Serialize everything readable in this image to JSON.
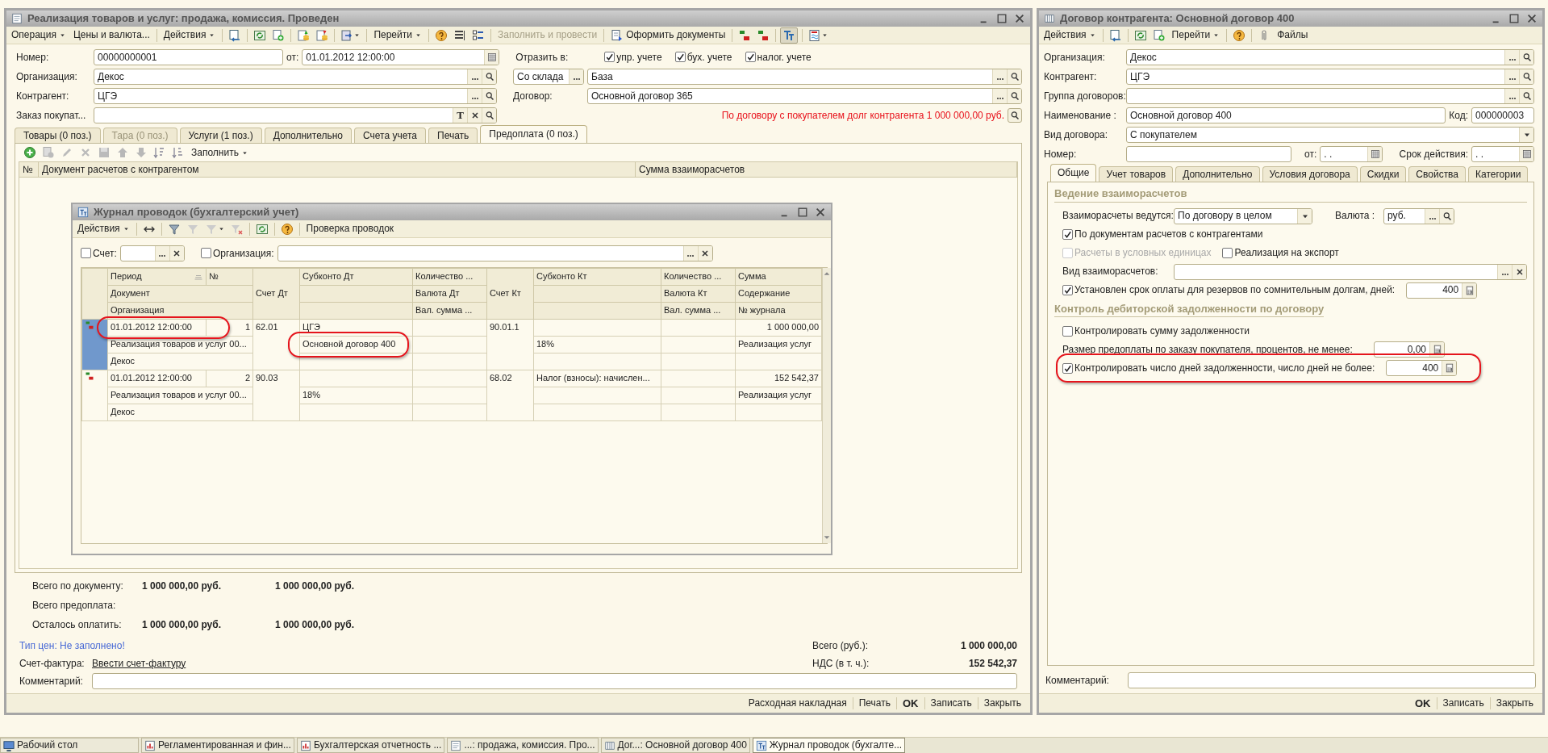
{
  "document_window": {
    "title": "Реализация товаров и услуг: продажа, комиссия. Проведен",
    "toolbar": [
      {
        "label": "Операция",
        "dropdown": true,
        "disabled": false
      },
      {
        "label": "Цены и валюта...",
        "dropdown": false,
        "disabled": false
      },
      {
        "label": "Действия",
        "dropdown": true,
        "disabled": false
      },
      {
        "label": "Перейти",
        "dropdown": true,
        "disabled": false
      },
      {
        "label": "Заполнить и провести",
        "dropdown": false,
        "disabled": true
      },
      {
        "label": "Оформить документы",
        "dropdown": false,
        "disabled": false
      }
    ],
    "toolbar_toggle": {
      "on": true
    },
    "number": {
      "label": "Номер:",
      "value": "00000000001",
      "kind": "text"
    },
    "date": {
      "label": "от:",
      "value": "01.01.2012 12:00:00",
      "kind": "date"
    },
    "reflect_in": {
      "label": "Отразить в:",
      "options": [
        {
          "label": "упр. учете",
          "checked": true
        },
        {
          "label": "бух. учете",
          "checked": true
        },
        {
          "label": "налог. учете",
          "checked": true
        }
      ]
    },
    "organization": {
      "label": "Организация:",
      "value": "Декос",
      "kind": "ref"
    },
    "warehouse_mode": {
      "value": "Со склада",
      "kind": "ref-dots"
    },
    "warehouse": {
      "value": "База",
      "kind": "ref"
    },
    "counterparty": {
      "label": "Контрагент:",
      "value": "ЦГЭ",
      "kind": "ref"
    },
    "contract": {
      "label": "Договор:",
      "value": "Основной договор 365",
      "kind": "ref"
    },
    "order": {
      "label": "Заказ покупат...",
      "kind": "typed-ref",
      "type_button": "T"
    },
    "debt_warning": "По договору с покупателем долг контрагента 1 000 000,00 руб.",
    "tabs": [
      {
        "label": "Товары (0 поз.)",
        "selected": false,
        "disabled": false
      },
      {
        "label": "Тара (0 поз.)",
        "selected": false,
        "disabled": true
      },
      {
        "label": "Услуги (1 поз.)",
        "selected": false,
        "disabled": false
      },
      {
        "label": "Дополнительно",
        "selected": false,
        "disabled": false
      },
      {
        "label": "Счета учета",
        "selected": false,
        "disabled": false
      },
      {
        "label": "Печать",
        "selected": false,
        "disabled": false
      },
      {
        "label": "Предоплата (0 поз.)",
        "selected": true,
        "disabled": false
      }
    ],
    "fill_button": "Заполнить",
    "prepayment_columns": [
      "№",
      "Документ расчетов с контрагентом",
      "Сумма взаиморасчетов"
    ],
    "totals": [
      {
        "label": "Всего по документу:",
        "values": [
          "1 000 000,00 руб.",
          "1 000 000,00 руб."
        ]
      },
      {
        "label": "Всего предоплата:"
      },
      {
        "label": "Осталось оплатить:",
        "values": [
          "1 000 000,00 руб.",
          "1 000 000,00 руб."
        ]
      }
    ],
    "price_type_warning": "Тип цен: Не заполнено!",
    "invoice": {
      "label": "Счет-фактура:",
      "link": "Ввести счет-фактуру"
    },
    "summary": [
      {
        "label": "Всего (руб.):",
        "value": "1 000 000,00"
      },
      {
        "label": "НДС (в т. ч.):",
        "value": "152 542,37"
      }
    ],
    "comment": {
      "label": "Комментарий:"
    },
    "footer_buttons": [
      {
        "label": "Расходная накладная",
        "default": false
      },
      {
        "label": "Печать",
        "default": false
      },
      {
        "label": "OK",
        "default": true
      },
      {
        "label": "Записать",
        "default": false
      },
      {
        "label": "Закрыть",
        "default": false
      }
    ]
  },
  "contract_window": {
    "title": "Договор контрагента: Основной договор 400",
    "toolbar": [
      {
        "label": "Действия",
        "dropdown": true
      },
      {
        "label": "Перейти",
        "dropdown": true
      },
      {
        "label": "Файлы",
        "dropdown": false
      }
    ],
    "organization": {
      "label": "Организация:",
      "value": "Декос",
      "kind": "ref"
    },
    "counterparty": {
      "label": "Контрагент:",
      "value": "ЦГЭ",
      "kind": "ref"
    },
    "group": {
      "label": "Группа договоров:",
      "kind": "ref"
    },
    "name": {
      "label": "Наименование :",
      "value": "Основной договор 400",
      "kind": "text"
    },
    "code": {
      "label": "Код:",
      "value": "000000003",
      "kind": "text"
    },
    "type": {
      "label": "Вид договора:",
      "value": "С покупателем",
      "kind": "select"
    },
    "number": {
      "label": "Номер:",
      "kind": "text"
    },
    "date": {
      "label": "от:",
      "value": ". .",
      "kind": "date"
    },
    "validity": {
      "label": "Срок действия:",
      "value": ". .",
      "kind": "date"
    },
    "tabs": [
      {
        "label": "Общие",
        "selected": true
      },
      {
        "label": "Учет товаров",
        "selected": false
      },
      {
        "label": "Дополнительно",
        "selected": false
      },
      {
        "label": "Условия договора",
        "selected": false
      },
      {
        "label": "Скидки",
        "selected": false
      },
      {
        "label": "Свойства",
        "selected": false
      },
      {
        "label": "Категории",
        "selected": false
      }
    ],
    "settlements": {
      "heading": "Ведение взаиморасчетов",
      "mode": {
        "label": "Взаиморасчеты ведутся:",
        "value": "По договору в целом",
        "kind": "select"
      },
      "currency": {
        "label": "Валюта :",
        "value": "руб.",
        "kind": "ref"
      },
      "by_documents": {
        "label": "По документам расчетов с контрагентами",
        "checked": true,
        "disabled": false
      },
      "conventional_units": {
        "label": "Расчеты в условных единицах",
        "checked": false,
        "disabled": true
      },
      "export": {
        "label": "Реализация на экспорт",
        "checked": false,
        "disabled": false
      },
      "settlement_type": {
        "label": "Вид взаиморасчетов:",
        "kind": "ref-clear"
      },
      "reserve_term": {
        "label": "Установлен срок оплаты для резервов по сомнительным долгам, дней:",
        "checked": true,
        "disabled": false,
        "value": "400",
        "kind": "num"
      }
    },
    "receivables_control": {
      "heading": "Контроль дебиторской задолженности по договору",
      "control_amount": {
        "label": "Контролировать сумму задолженности",
        "checked": false,
        "disabled": false
      },
      "prepayment_size": {
        "label": "Размер предоплаты по заказу покупателя, процентов, не менее:",
        "value": "0,00",
        "kind": "num"
      },
      "control_days": {
        "label": "Контролировать число дней задолженности, число дней не более:",
        "checked": true,
        "disabled": false,
        "value": "400",
        "kind": "num",
        "highlighted": true
      }
    },
    "comment": {
      "label": "Комментарий:"
    },
    "footer_buttons": [
      {
        "label": "OK",
        "default": true
      },
      {
        "label": "Записать",
        "default": false
      },
      {
        "label": "Закрыть",
        "default": false
      }
    ]
  },
  "journal_window": {
    "title": "Журнал проводок (бухгалтерский учет)",
    "toolbar": [
      {
        "label": "Действия",
        "dropdown": true
      },
      {
        "label": "Проверка проводок",
        "dropdown": false
      }
    ],
    "filters": [
      {
        "label": "Счет:",
        "checked": false,
        "kind": "short"
      },
      {
        "label": "Организация:",
        "checked": false,
        "kind": "long"
      }
    ],
    "columns": {
      "period": "Период",
      "number": "№",
      "document": "Документ",
      "organization": "Организация",
      "account_dt": "Счет Дт",
      "subconto_dt": "Субконто Дт",
      "quantity_dt": "Количество ...",
      "currency_dt": "Валюта Дт",
      "currency_amount_dt": "Вал. сумма ...",
      "account_kt": "Счет Кт",
      "subconto_kt": "Субконто Кт",
      "quantity_kt": "Количество ...",
      "currency_kt": "Валюта Кт",
      "currency_amount_kt": "Вал. сумма ...",
      "amount": "Сумма",
      "content": "Содержание",
      "journal_number": "№ журнала"
    },
    "entries": [
      {
        "selected": true,
        "period_highlighted": true,
        "subconto_highlighted": true,
        "period": "01.01.2012 12:00:00",
        "number": "1",
        "document": "Реализация товаров и услуг 00...",
        "organization": "Декос",
        "account_dt": "62.01",
        "subconto_dt_1": "ЦГЭ",
        "subconto_dt_2": "Основной договор 400",
        "account_kt": "90.01.1",
        "subconto_kt_2": "18%",
        "amount": "1 000 000,00",
        "content": "Реализация услуг"
      },
      {
        "selected": false,
        "period_highlighted": false,
        "subconto_highlighted": false,
        "period": "01.01.2012 12:00:00",
        "number": "2",
        "document": "Реализация товаров и услуг 00...",
        "organization": "Декос",
        "account_dt": "90.03",
        "subconto_dt_2": "18%",
        "account_kt": "68.02",
        "subconto_kt_1": "Налог (взносы): начислен...",
        "amount": "152 542,37",
        "content": "Реализация услуг"
      }
    ]
  },
  "taskbar": [
    {
      "label": "Рабочий стол",
      "selected": false,
      "kind": "desktop"
    },
    {
      "label": "Регламентированная и фин...",
      "selected": false,
      "kind": "report"
    },
    {
      "label": "Бухгалтерская отчетность ...",
      "selected": false,
      "kind": "report"
    },
    {
      "label": "...: продажа, комиссия. Про...",
      "selected": false,
      "kind": "document"
    },
    {
      "label": "Дог...: Основной договор 400",
      "selected": false,
      "kind": "catalog"
    },
    {
      "label": "Журнал проводок (бухгалте...",
      "selected": true,
      "kind": "journal"
    }
  ]
}
